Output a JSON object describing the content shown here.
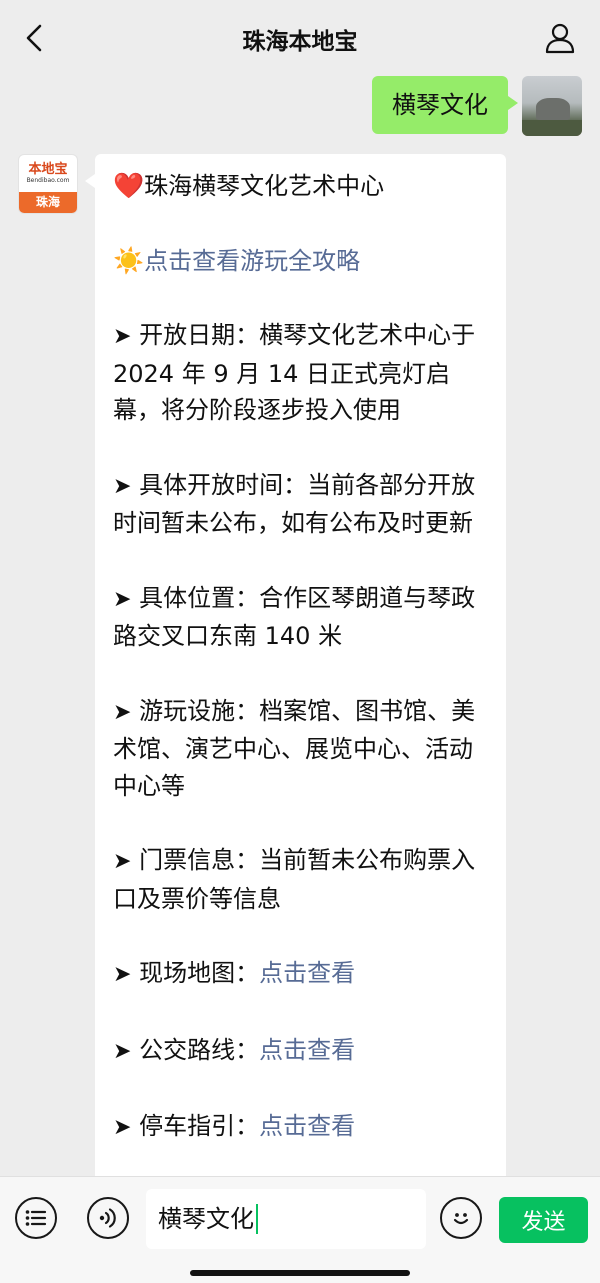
{
  "header": {
    "title": "珠海本地宝"
  },
  "my_message": {
    "text": "横琴文化"
  },
  "account_avatar": {
    "main": "本地宝",
    "domain": "Bendibao.com",
    "city": "珠海"
  },
  "reply": {
    "heart_emoji": "❤️",
    "title": "珠海横琴文化艺术中心",
    "sun_emoji": "☀️",
    "guide_link": "点击查看游玩全攻略",
    "arrow": "➤",
    "items": [
      {
        "label": "开放日期：",
        "text": "横琴文化艺术中心于 2024 年 9 月 14 日正式亮灯启幕，将分阶段逐步投入使用"
      },
      {
        "label": "具体开放时间：",
        "text": "当前各部分开放时间暂未公布，如有公布及时更新"
      },
      {
        "label": "具体位置：",
        "text": "合作区琴朗道与琴政路交叉口东南 140 米"
      },
      {
        "label": "游玩设施：",
        "text": "档案馆、图书馆、美术馆、演艺中心、展览中心、活动中心等"
      },
      {
        "label": "门票信息：",
        "text": "当前暂未公布购票入口及票价等信息"
      },
      {
        "label": "现场地图：",
        "link": "点击查看"
      },
      {
        "label": "公交路线：",
        "link": "点击查看"
      },
      {
        "label": "停车指引：",
        "link": "点击查看"
      }
    ]
  },
  "input_bar": {
    "input_value": "横琴文化",
    "send_label": "发送"
  }
}
